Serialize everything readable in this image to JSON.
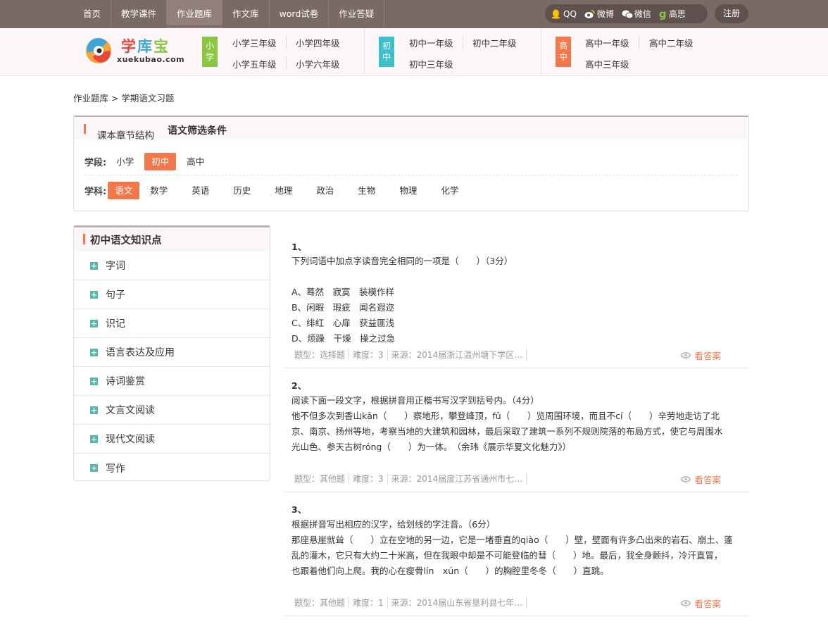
{
  "nav": {
    "items": [
      "首页",
      "教学课件",
      "作业题库",
      "作文库",
      "word试卷",
      "作业答疑"
    ],
    "active_index": 2
  },
  "social": {
    "items": [
      {
        "label": "QQ",
        "icon": "qq-icon"
      },
      {
        "label": "微博",
        "icon": "weibo-icon"
      },
      {
        "label": "微信",
        "icon": "wechat-icon"
      },
      {
        "label": "高思",
        "icon": "gaosi-icon"
      }
    ],
    "register": "注册"
  },
  "logo": {
    "name": "学库宝",
    "url_text": "xuekubao.com"
  },
  "grades": {
    "primary": {
      "tag": "小学",
      "color": "#8cc63f",
      "links": [
        "小学三年级",
        "小学四年级",
        "小学五年级",
        "小学六年级"
      ]
    },
    "middle": {
      "tag": "初中",
      "color": "#3ec1c9",
      "links": [
        "初中一年级",
        "初中二年级",
        "初中三年级"
      ]
    },
    "high": {
      "tag": "高中",
      "color": "#f2784b",
      "links": [
        "高中一年级",
        "高中二年级",
        "高中三年级"
      ]
    }
  },
  "breadcrumb": "作业题库 > 学期语文习题",
  "filter": {
    "tab1": "课本章节结构",
    "tab2": "语文筛选条件",
    "stage_label": "学段:",
    "stages": [
      "小学",
      "初中",
      "高中"
    ],
    "active_stage": "初中",
    "subject_label": "学科:",
    "subjects": [
      "语文",
      "数学",
      "英语",
      "历史",
      "地理",
      "政治",
      "生物",
      "物理",
      "化学"
    ],
    "active_subject": "语文"
  },
  "sidebar": {
    "title": "初中语文知识点",
    "items": [
      "字词",
      "句子",
      "识记",
      "语言表达及应用",
      "诗词鉴赏",
      "文言文阅读",
      "现代文阅读",
      "写作"
    ]
  },
  "questions": [
    {
      "num": "1、",
      "lines": [
        "下列词语中加点字读音完全相同的一项是（　　）（3分）",
        "",
        "A、蓦然　寂寞　装模作样",
        "B、闲暇　瑕疵　闻名遐迩",
        "C、绯红　心扉　获益匪浅",
        "D、烦躁　干燥　操之过急"
      ],
      "type": "题型：选择题",
      "difficulty": "难度：3",
      "source": "来源：2014届浙江温州塘下学区…",
      "answer": "看答案"
    },
    {
      "num": "2、",
      "lines": [
        "阅读下面一段文字，根据拼音用正楷书写汉字到括号内。（4分）",
        "他不但多次到香山kān（　　）察地形，攀登峰顶，fǔ（　　）览周围环境，而且不cí（　　）辛劳地走访了北",
        "京、南京、扬州等地，考察当地的大建筑和园林，最后采取了建筑一系列不规则院落的布局方式，使它与周围水",
        "光山色、参天古树róng（　　）为一体。　（余玮《展示华夏文化魅力》）"
      ],
      "type": "题型：其他题",
      "difficulty": "难度：3",
      "source": "来源：2014届度江苏省通州市七…",
      "answer": "看答案"
    },
    {
      "num": "3、",
      "lines": [
        "根据拼音写出相应的汉字，给划线的字注音。（6分）",
        "那座悬崖就耸（　　）立在空地的另一边，它是一堵垂直的qiào（　　）壁，壁面有许多凸出来的岩石、崩土、蓬",
        "乱的灌木，它只有大约二十米高，但在我眼中却是不可能登临的彗（　　）地。最后，我全身颤抖，冷汗直冒，",
        "也跟着他们向上爬。我的心在瘦骨lín　xún（　　）的胸腔里冬冬（　　）直跳。"
      ],
      "type": "题型：其他题",
      "difficulty": "难度：1",
      "source": "来源：2014届山东省垦利县七年…",
      "answer": "看答案"
    }
  ]
}
